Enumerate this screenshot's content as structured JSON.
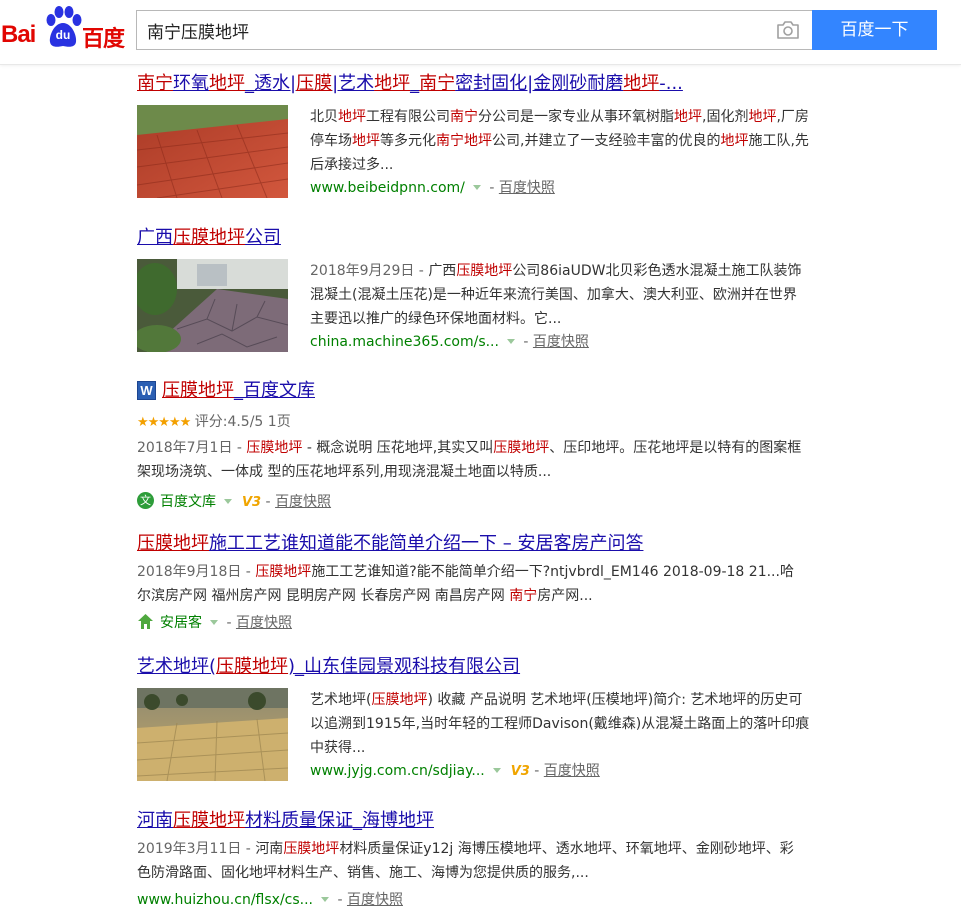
{
  "brand": {
    "logo_latin": "Bai",
    "logo_du": "du",
    "logo_cn": "百度"
  },
  "search": {
    "query": "南宁压膜地坪",
    "button_label": "百度一下"
  },
  "common": {
    "snapshot": "百度快照",
    "sep": " - ",
    "v3": "V3"
  },
  "results": [
    {
      "title_parts": [
        "南宁",
        "环氧",
        "地坪",
        "_透水|",
        "压膜",
        "|艺术",
        "地坪",
        "_",
        "南宁",
        "密封固化|金刚砂耐磨",
        "地坪",
        "-..."
      ],
      "abstract_parts": [
        "北贝",
        "地坪",
        "工程有限公司",
        "南宁",
        "分公司是一家专业从事环氧树脂",
        "地坪",
        ",固化剂",
        "地坪",
        ",厂房停车场",
        "地坪",
        "等多元化",
        "南宁",
        "地坪",
        "公司,并建立了一支经验丰富的优良的",
        "地坪",
        "施工队,先后承接过多..."
      ],
      "url": "www.beibeidpnn.com/"
    },
    {
      "title_parts": [
        "广西",
        "压膜地坪",
        "公司"
      ],
      "date": "2018年9月29日",
      "abstract_parts": [
        "广西",
        "压膜地坪",
        "公司86iaUDW北贝彩色透水混凝土施工队装饰混凝土(混凝土压花)是一种近年来流行美国、加拿大、澳大利亚、欧洲并在世界主要迅以推广的绿色环保地面材料。它..."
      ],
      "url": "china.machine365.com/s..."
    },
    {
      "title_parts": [
        "压膜地坪",
        "_百度文库"
      ],
      "rating_text": "评分:4.5/5",
      "pages_text": "1页",
      "date": "2018年7月1日",
      "abstract_parts": [
        "压膜地坪",
        " - 概念说明 压花地坪,其实又叫",
        "压膜地坪",
        "、压印地坪。压花地坪是以特有的图案框架现场浇筑、一体成 型的压花地坪系列,用现浇混凝土地面以特质..."
      ],
      "site": "百度文库"
    },
    {
      "title_parts": [
        "压膜地坪",
        "施工工艺谁知道能不能简单介绍一下 – 安居客房产问答"
      ],
      "date": "2018年9月18日",
      "abstract_parts": [
        "压膜地坪",
        "施工工艺谁知道?能不能简单介绍一下?ntjvbrdl_EM146 2018-09-18 21...哈尔滨房产网 福州房产网 昆明房产网 长春房产网 南昌房产网 ",
        "南宁",
        "房产网..."
      ],
      "site": "安居客"
    },
    {
      "title_parts": [
        "艺术地坪(",
        "压膜地坪",
        ")_山东佳园景观科技有限公司"
      ],
      "abstract_parts": [
        "艺术地坪(",
        "压膜地坪",
        ") 收藏 产品说明 艺术地坪(压模地坪)简介: 艺术地坪的历史可以追溯到1915年,当时年轻的工程师Davison(戴维森)从混凝土路面上的落叶印痕中获得..."
      ],
      "url": "www.jyjg.com.cn/sdjiay..."
    },
    {
      "title_parts": [
        "河南",
        "压膜地坪",
        "材料质量保证_海博地坪"
      ],
      "date": "2019年3月11日",
      "abstract_parts": [
        "河南",
        "压膜地坪",
        "材料质量保证y12j 海博压模地坪、透水地坪、环氧地坪、金刚砂地坪、彩色防滑路面、固化地坪材料生产、销售、施工、海博为您提供质的服务,..."
      ],
      "url": "www.huizhou.cn/flsx/cs..."
    }
  ],
  "colors": {
    "brand_red": "#e10602",
    "link_blue": "#1a0dab",
    "highlight_red": "#c00000",
    "url_green": "#008000",
    "button_blue": "#3385ff"
  }
}
